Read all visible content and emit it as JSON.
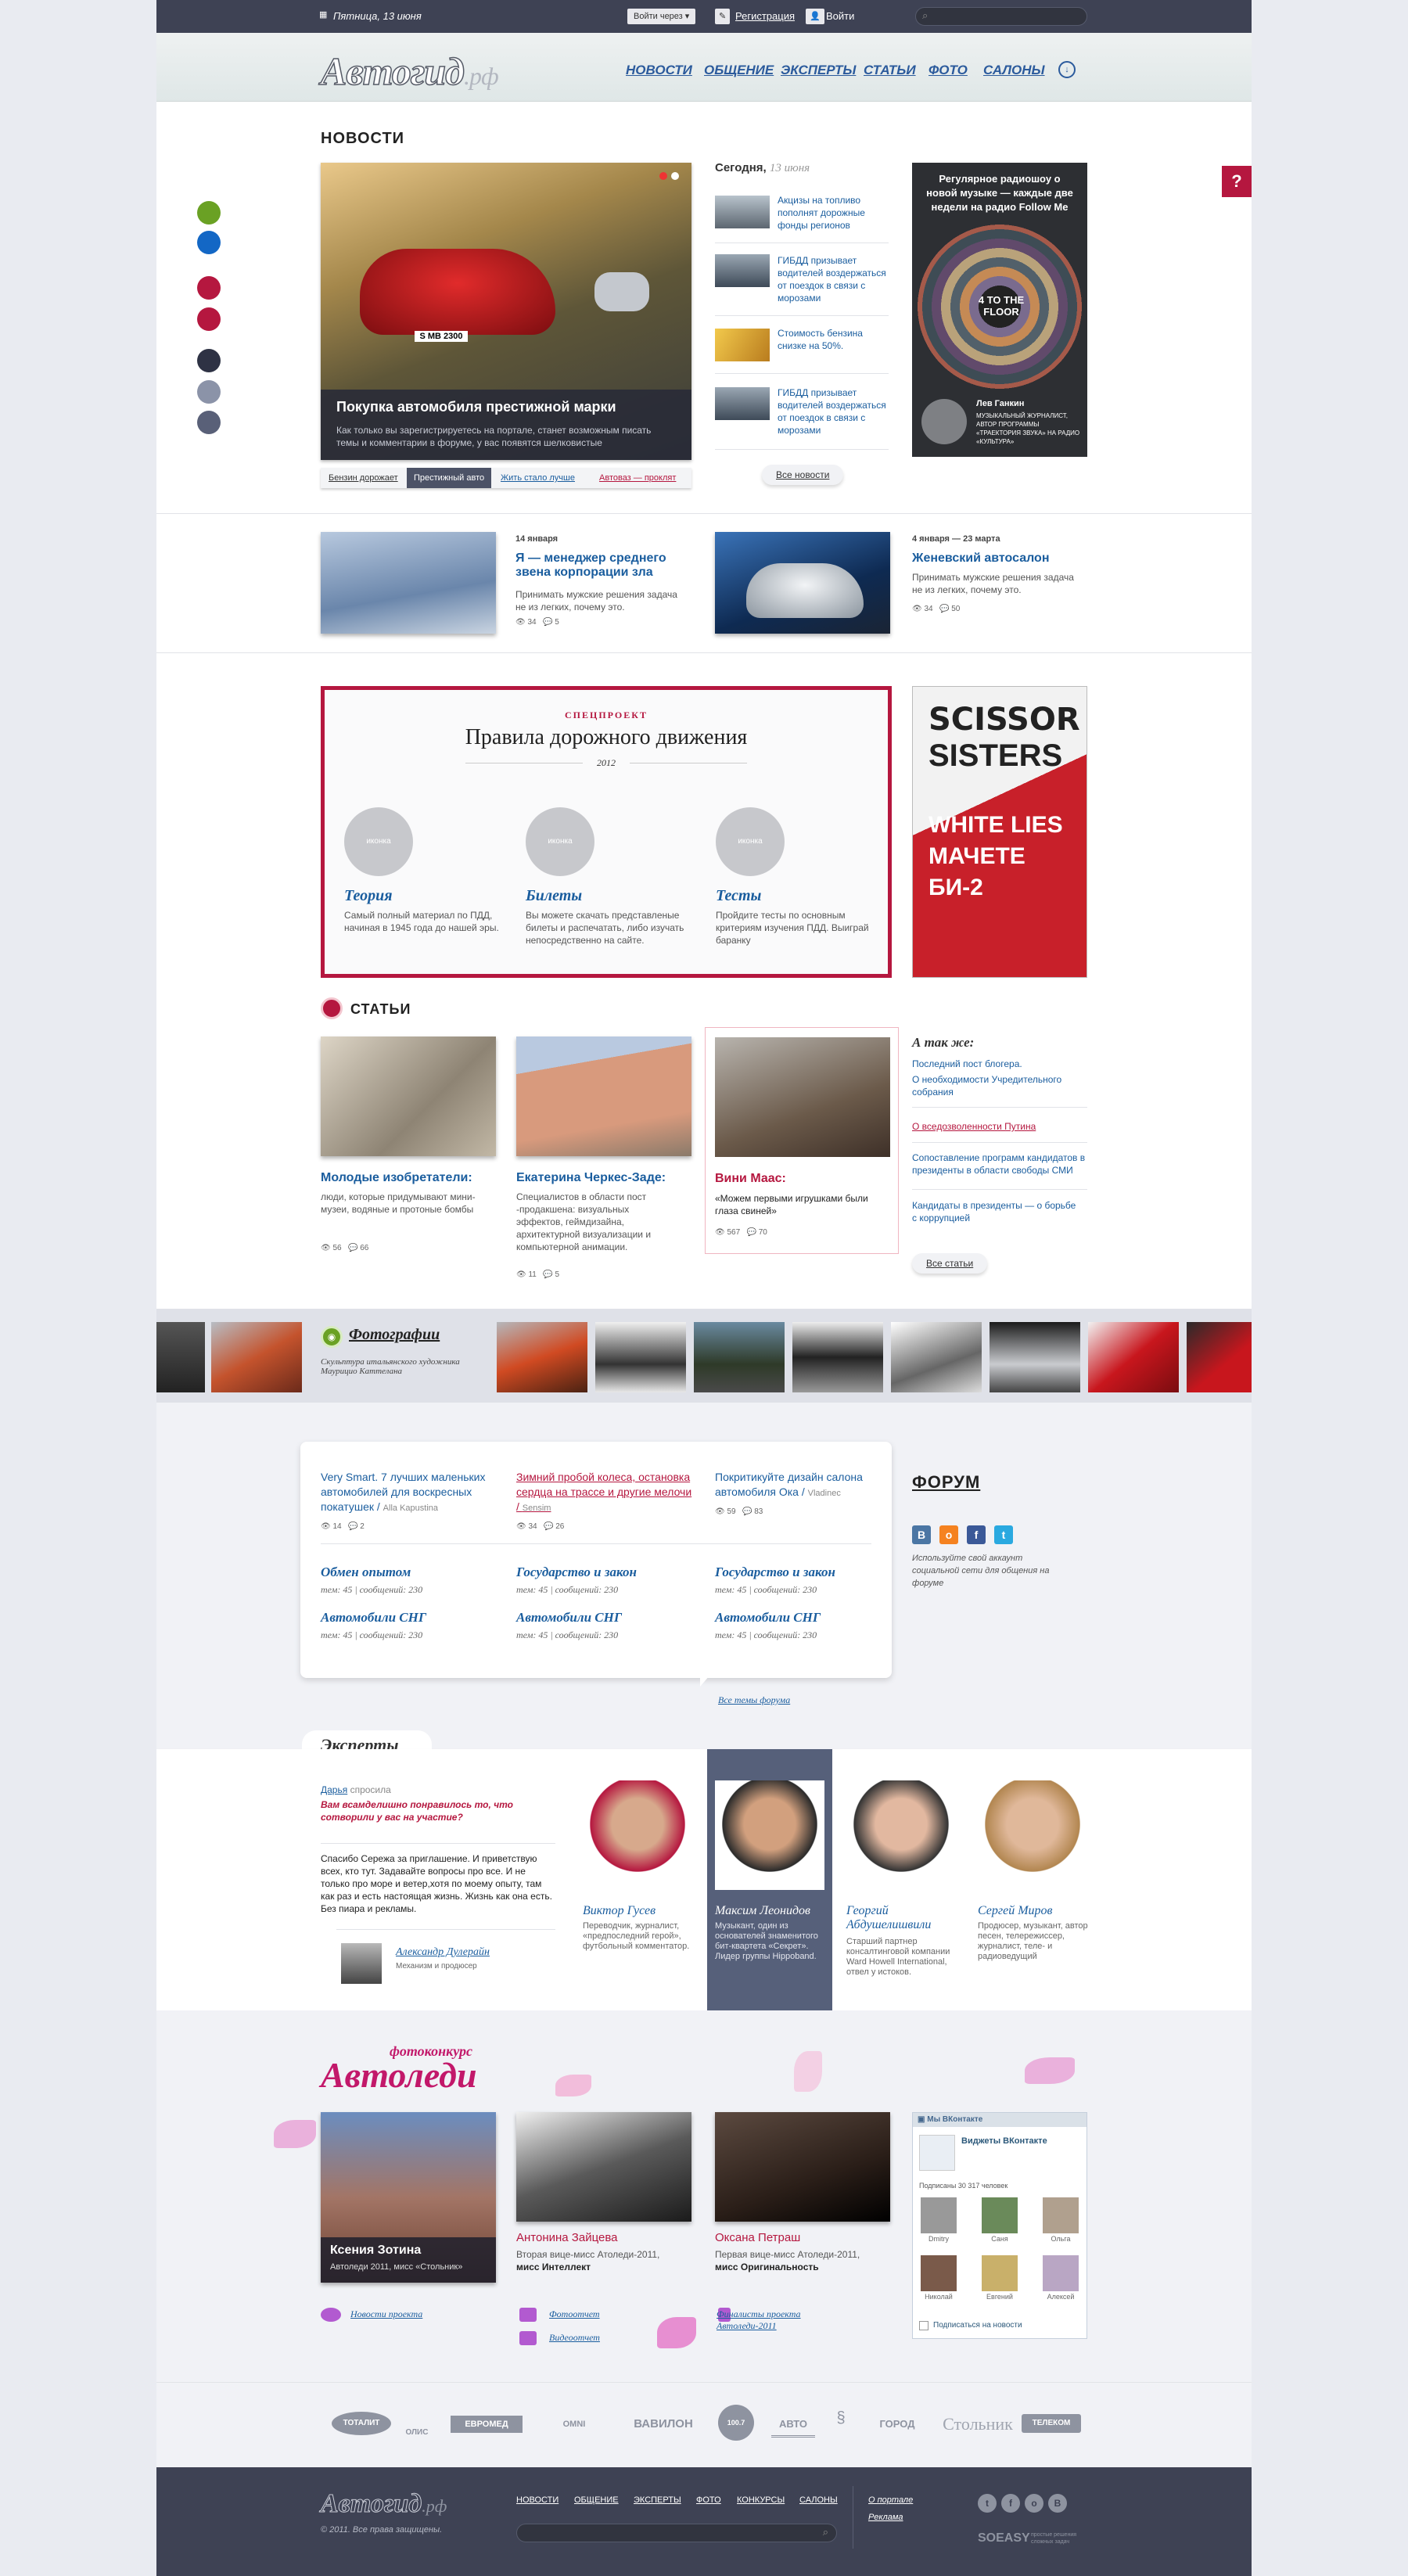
{
  "topbar": {
    "date": "Пятница, 13 июня",
    "login_via": "Войти через",
    "register": "Регистрация",
    "login": "Войти"
  },
  "header": {
    "logo": "Автогид",
    "logo_suffix": ".рф",
    "nav": [
      "НОВОСТИ",
      "ОБЩЕНИЕ",
      "ЭКСПЕРТЫ",
      "СТАТЬИ",
      "ФОТО",
      "САЛОНЫ"
    ]
  },
  "news": {
    "title": "НОВОСТИ",
    "feature_title": "Покупка автомобиля престижной марки",
    "feature_text": "Как только вы зарегистрируетесь на портале, станет возможным писать темы и комментарии в форуме, у вас появятся шелковистые",
    "plate": "S MB 2300",
    "tabs": [
      "Бензин дорожает",
      "Престижный авто",
      "Жить стало лучше",
      "Автоваз — проклят"
    ],
    "today_label": "Сегодня,",
    "today_date": "13 июня",
    "items": [
      "Акцизы на топливо пополнят дорожные фонды регионов",
      "ГИБДД призывает водителей воздержаться от поездок в связи с морозами",
      "Стоимость бензина снизке на 50%.",
      "ГИБДД призывает водителей воздержаться от поездок в связи с морозами"
    ],
    "all_news": "Все новости",
    "ad_text": "Регулярное радиошоу о новой музыке — каждые две недели на радио Follow Me",
    "ad_logo": "4 TO THE FLOOR",
    "ad_person": "Лев Ганкин",
    "ad_person_desc": "МУЗЫКАЛЬНЫЙ ЖУРНАЛИСТ, АВТОР ПРОГРАММЫ «ТРАЕКТОРИЯ ЗВУКА» НА РАДИО «КУЛЬТУРА»"
  },
  "news2": [
    {
      "date": "14 января",
      "title": "Я — менеджер среднего звена корпорации зла",
      "text": "Принимать мужские решения задача не из легких, почему это.",
      "views": "34",
      "comments": "5"
    },
    {
      "date": "4 января — 23 марта",
      "title": "Женевский автосалон",
      "text": "Принимать мужские решения задача не из легких, почему это.",
      "views": "34",
      "comments": "50"
    }
  ],
  "special": {
    "kicker": "СПЕЦПРОЕКТ",
    "title": "Правила дорожного движения",
    "year": "2012",
    "icon_label": "иконка",
    "items": [
      {
        "title": "Теория",
        "text": "Самый полный материал по ПДД, начиная в 1945 года до нашей эры."
      },
      {
        "title": "Билеты",
        "text": "Вы можете скачать представленые билеты и распечатать, либо изучать непосредственно на сайте."
      },
      {
        "title": "Тесты",
        "text": "Пройдите тесты по основным критериям изучения ПДД. Выиграй баранку"
      }
    ],
    "ad_lines": [
      "SCISSOR",
      "SISTERS",
      "WHITE LIES",
      "МАЧЕТЕ",
      "БИ-2"
    ]
  },
  "articles": {
    "title": "СТАТЬИ",
    "items": [
      {
        "title": "Молодые изобретатели:",
        "text": "люди, которые придумывают мини-музеи, водяные и протоные бомбы",
        "views": "56",
        "comments": "66"
      },
      {
        "title": "Екатерина Черкес-Заде:",
        "text": "Специалистов в области пост -продакшена: визуальных эффектов, геймдизайна, архитектурной визуализации и компьютерной анимации.",
        "views": "11",
        "comments": "5"
      },
      {
        "title": "Вини Маас:",
        "text": "«Можем первыми игрушками были глаза свиней»",
        "views": "567",
        "comments": "70"
      }
    ],
    "also_title": "А так же:",
    "also": [
      "Последний пост блогера.",
      "О необходимости Учредительного собрания",
      "О вседозволенности Путина",
      "Сопоставление программ кандидатов в президенты в области свободы СМИ",
      "Кандидаты в президенты — о борьбе с коррупцией"
    ],
    "all": "Все статьи"
  },
  "photos": {
    "title": "Фотографии",
    "caption": "Скульптура итальянского художника Маурицио Каттелана"
  },
  "forum": {
    "top": [
      {
        "title": "Very Smart. 7 лучших маленьких автомобилей для воскресных покатушек",
        "author": "Alla Kapustina",
        "views": "14",
        "comments": "2"
      },
      {
        "title": "Зимний пробой колеса, остановка сердца на трассе и другие мелочи",
        "author": "Sensim",
        "views": "34",
        "comments": "26"
      },
      {
        "title": "Покритикуйте дизайн салона автомобиля Ока",
        "author": "Vladinec",
        "views": "59",
        "comments": "83"
      }
    ],
    "topics": [
      {
        "title": "Обмен опытом",
        "meta": "тем: 45 | сообщений: 230"
      },
      {
        "title": "Государство и закон",
        "meta": "тем: 45 | сообщений: 230"
      },
      {
        "title": "Государство и закон",
        "meta": "тем: 45 | сообщений: 230"
      },
      {
        "title": "Автомобили СНГ",
        "meta": "тем: 45 | сообщений: 230"
      },
      {
        "title": "Автомобили СНГ",
        "meta": "тем: 45 | сообщений: 230"
      },
      {
        "title": "Автомобили СНГ",
        "meta": "тем: 45 | сообщений: 230"
      }
    ],
    "all": "Все темы форума",
    "side_title": "ФОРУМ",
    "side_text": "Используйте свой аккаунт социальной сети для общения на форуме"
  },
  "experts": {
    "title": "Эксперты",
    "asker": "Дарья",
    "asker_suffix": "спросила",
    "question": "Вам всамделишно понравилось то, что сотворили у вас на участие?",
    "answer": "Спасибо Сережа за приглашение. И приветствую всех, кто тут. Задавайте вопросы про все. И не только про море и ветер,хотя по моему опыту, там как раз и есть настоящая жизнь. Жизнь как она есть. Без пиара и рекламы.",
    "author": "Александр Дулерайн",
    "author_role": "Механизм и продюсер",
    "list": [
      {
        "name": "Виктор Гусев",
        "text": "Переводчик, журналист, «предпоследний герой», футбольный комментатор."
      },
      {
        "name": "Максим Леонидов",
        "text": "Музыкант, один из основателей знаменитого бит-квартета «Секрет». Лидер группы Hippoband."
      },
      {
        "name": "Георгий Абдушелишвили",
        "text": "Старший партнер консалтинговой компании Ward Howell International, отвел у истоков."
      },
      {
        "name": "Сергей Миров",
        "text": "Продюсер, музыкант, автор песен, телережиссер, журналист, теле- и радиоведущий"
      }
    ]
  },
  "contest": {
    "kicker": "фотоконкурс",
    "title": "Автоледи",
    "women": [
      {
        "name": "Ксения Зотина",
        "desc": "Автоледи 2011, мисс «Стольник»"
      },
      {
        "name": "Антонина Зайцева",
        "desc": "Вторая вице-мисс Атоледи-2011,",
        "desc2": "мисс Интеллект"
      },
      {
        "name": "Оксана Петраш",
        "desc": "Первая вице-мисс Атоледи-2011,",
        "desc2": "мисс Оригинальность"
      }
    ],
    "links": [
      "Новости проекта",
      "Фотоотчет",
      "Видеоотчет",
      "Финалисты проекта Автоледи-2011"
    ],
    "vk_header": "Мы ВКонтакте",
    "vk_title": "Виджеты ВКонтакте",
    "vk_count": "Подписаны 30 317 человек",
    "vk_people": [
      "Dmitry",
      "Саня",
      "Ольга",
      "Николай",
      "Евгений",
      "Алексей"
    ],
    "vk_subscribe": "Подписаться на новости"
  },
  "partners": [
    "ТОТАЛИТ",
    "ОЛИС",
    "ЕВРОМЕД",
    "OMNI",
    "ВАВИЛОН",
    "100.7",
    "АВТО",
    "",
    "ГОРОД",
    "Стольник",
    "ТЕЛЕКОМ"
  ],
  "footer": {
    "logo": "Автогид",
    "logo_suffix": ".рф",
    "copy": "© 2011. Все права защищены.",
    "nav": [
      "НОВОСТИ",
      "ОБЩЕНИЕ",
      "ЭКСПЕРТЫ",
      "ФОТО",
      "КОНКУРСЫ",
      "САЛОНЫ"
    ],
    "links": [
      "О портале",
      "Реклама"
    ],
    "brand": "SOEASY",
    "brand_sub": "простые решения сложных задач"
  },
  "colors": {
    "accent": "#b5173f",
    "nav_blue": "#2b5a9c",
    "dark": "#3e4254",
    "pink": "#c2186a"
  }
}
